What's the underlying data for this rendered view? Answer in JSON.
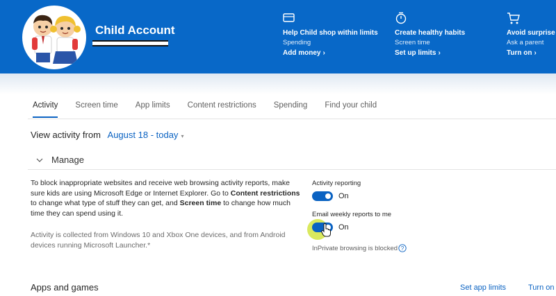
{
  "account": {
    "name": "Child Account"
  },
  "promos": [
    {
      "title": "Help Child shop within limits",
      "subtitle": "Spending",
      "link": "Add money",
      "icon": "wallet-icon"
    },
    {
      "title": "Create healthy habits",
      "subtitle": "Screen time",
      "link": "Set up limits",
      "icon": "timer-icon"
    },
    {
      "title": "Avoid surprise sp",
      "subtitle": "Ask a parent",
      "link": "Turn on",
      "icon": "cart-icon"
    }
  ],
  "tabs": [
    {
      "label": "Activity",
      "active": true
    },
    {
      "label": "Screen time"
    },
    {
      "label": "App limits"
    },
    {
      "label": "Content restrictions"
    },
    {
      "label": "Spending"
    },
    {
      "label": "Find your child"
    }
  ],
  "view": {
    "prefix": "View activity from",
    "date_range": "August 18 - today"
  },
  "manage": {
    "label": "Manage"
  },
  "description": {
    "part1": "To block inappropriate websites and receive web browsing activity reports, make sure kids are using Microsoft Edge or Internet Explorer. Go to ",
    "bold1": "Content restrictions",
    "part2": " to change what type of stuff they can get, and ",
    "bold2": "Screen time",
    "part3": " to change how much time they can spend using it."
  },
  "note": "Activity is collected from Windows 10 and Xbox One devices, and from Android devices running Microsoft Launcher.*",
  "settings": {
    "activity_reporting": {
      "label": "Activity reporting",
      "state": "On"
    },
    "email_reports": {
      "label": "Email weekly reports to me",
      "state": "On"
    },
    "inprivate": "InPrivate browsing is blocked"
  },
  "apps": {
    "title": "Apps and games",
    "set_limits": "Set app limits",
    "turn_on": "Turn on"
  },
  "colors": {
    "header_blue": "#0868c8",
    "accent_blue": "#0a62c2",
    "highlight": "#cde128"
  }
}
